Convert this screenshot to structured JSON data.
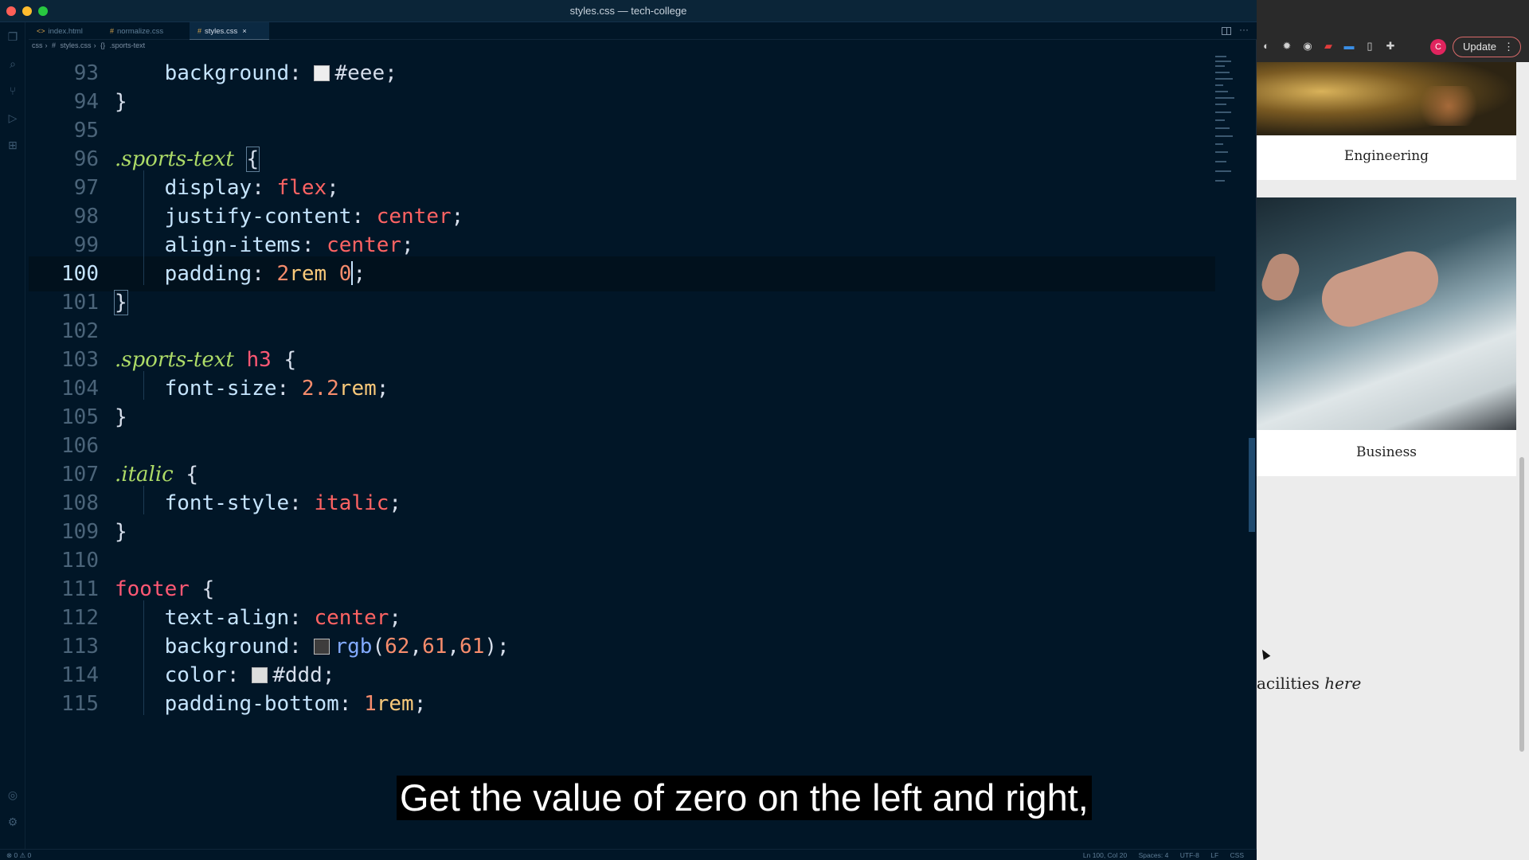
{
  "window": {
    "title": "styles.css — tech-college"
  },
  "tabs": [
    {
      "label": "index.html",
      "icon": "<>"
    },
    {
      "label": "normalize.css",
      "icon": "#"
    },
    {
      "label": "styles.css",
      "icon": "#"
    }
  ],
  "breadcrumb": [
    "css",
    "#",
    "styles.css",
    "{}",
    ".sports-text"
  ],
  "code_lines": [
    {
      "n": "93"
    },
    {
      "n": "94"
    },
    {
      "n": "95"
    },
    {
      "n": "96"
    },
    {
      "n": "97"
    },
    {
      "n": "98"
    },
    {
      "n": "99"
    },
    {
      "n": "100"
    },
    {
      "n": "101"
    },
    {
      "n": "102"
    },
    {
      "n": "103"
    },
    {
      "n": "104"
    },
    {
      "n": "105"
    },
    {
      "n": "106"
    },
    {
      "n": "107"
    },
    {
      "n": "108"
    },
    {
      "n": "109"
    },
    {
      "n": "110"
    },
    {
      "n": "111"
    },
    {
      "n": "112"
    },
    {
      "n": "113"
    },
    {
      "n": "114"
    },
    {
      "n": "115"
    }
  ],
  "code": {
    "l93": {
      "prop": "background",
      "value": "#eee",
      "swatch": "#eeeeee"
    },
    "l96": {
      "selector": ".sports-text"
    },
    "l97": {
      "prop": "display",
      "value": "flex"
    },
    "l98": {
      "prop": "justify-content",
      "value": "center"
    },
    "l99": {
      "prop": "align-items",
      "value": "center"
    },
    "l100": {
      "prop": "padding",
      "num1": "2",
      "unit1": "rem",
      "num2": "0"
    },
    "l103": {
      "selector": ".sports-text",
      "tag": "h3"
    },
    "l104": {
      "prop": "font-size",
      "num": "2.2",
      "unit": "rem"
    },
    "l107": {
      "selector": ".italic"
    },
    "l108": {
      "prop": "font-style",
      "value": "italic"
    },
    "l111": {
      "tag": "footer"
    },
    "l112": {
      "prop": "text-align",
      "value": "center"
    },
    "l113": {
      "prop": "background",
      "fn": "rgb",
      "args": [
        "62",
        "61",
        "61"
      ],
      "swatch": "#3e3d3d"
    },
    "l114": {
      "prop": "color",
      "value": "#ddd",
      "swatch": "#dddddd"
    },
    "l115": {
      "prop": "padding-bottom",
      "num": "1",
      "unit": "rem"
    }
  },
  "statusbar": {
    "left": "⊗ 0 ⚠ 0",
    "position": "Ln 100, Col 20",
    "spaces": "Spaces: 4",
    "encoding": "UTF-8",
    "eol": "LF",
    "language": "CSS"
  },
  "browser": {
    "update_label": "Update",
    "avatar_letter": "C",
    "cards": [
      {
        "label": "Engineering"
      },
      {
        "label": "Business"
      }
    ],
    "facilities_text": "acilities ",
    "facilities_em": "here"
  },
  "caption": "Get the value of zero on the left and right,",
  "colors": {
    "editor_bg": "#011627",
    "selector": "#addb67",
    "keyword": "#ff6363",
    "number": "#f78c6c"
  }
}
